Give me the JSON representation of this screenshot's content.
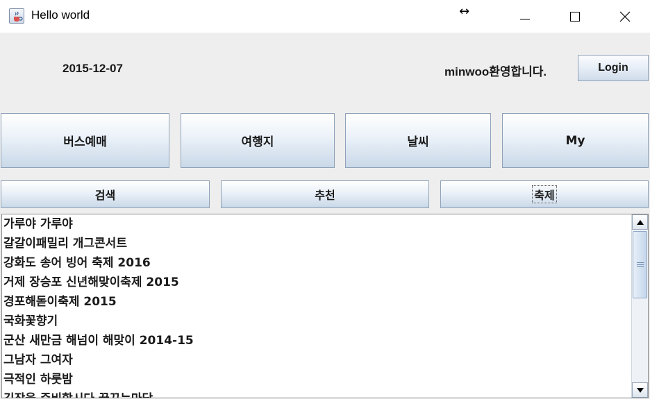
{
  "window": {
    "title": "Hello world",
    "resize_glyph": "↔",
    "icon": "java-coffee-icon"
  },
  "header": {
    "date": "2015-12-07",
    "welcome": "minwoo환영합니다.",
    "login_label": "Login"
  },
  "nav_primary": [
    {
      "label": "버스예매"
    },
    {
      "label": "여행지"
    },
    {
      "label": "날씨"
    },
    {
      "label": "My"
    }
  ],
  "nav_secondary": [
    {
      "label": "검색"
    },
    {
      "label": "추천"
    },
    {
      "label": "축제"
    }
  ],
  "festival_list": {
    "items": [
      "가루야 가루야",
      "갈갈이패밀리 개그콘서트",
      "강화도 송어 빙어 축제 2016",
      "거제 장승포 신년해맞이축제 2015",
      "경포해돋이축제 2015",
      "국화꽃향기",
      "군산 새만금 해넘이 해맞이 2014-15",
      "그남자 그여자",
      "극적인 하룻밤",
      "김장을 준비합시다 꿈꾸는마당"
    ]
  },
  "colors": {
    "panel_bg": "#eeeeee",
    "button_border": "#8fa2b8",
    "list_bg": "#ffffff"
  }
}
